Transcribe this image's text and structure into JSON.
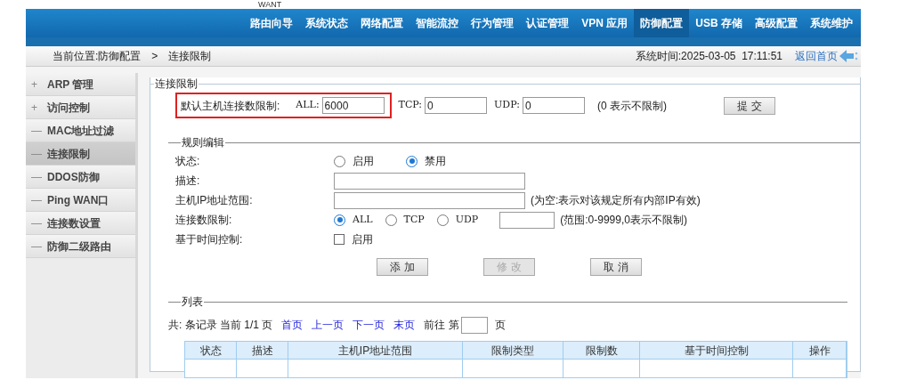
{
  "top_caption": "WANT",
  "nav": [
    {
      "label": "路由向导",
      "selected": false
    },
    {
      "label": "系统状态",
      "selected": false
    },
    {
      "label": "网络配置",
      "selected": false
    },
    {
      "label": "智能流控",
      "selected": false
    },
    {
      "label": "行为管理",
      "selected": false
    },
    {
      "label": "认证管理",
      "selected": false
    },
    {
      "label": "VPN 应用",
      "selected": false
    },
    {
      "label": "防御配置",
      "selected": true
    },
    {
      "label": "USB 存储",
      "selected": false
    },
    {
      "label": "高级配置",
      "selected": false
    },
    {
      "label": "系统维护",
      "selected": false
    }
  ],
  "breadcrumb": {
    "location": "当前位置:防御配置",
    "separator": ">",
    "current": "连接限制"
  },
  "system_time": "系统时间:2025-03-05  17:11:51",
  "home_link": "返回首页",
  "sidebar": [
    {
      "icon": "+",
      "label": "ARP 管理",
      "selected": false
    },
    {
      "icon": "+",
      "label": "访问控制",
      "selected": false
    },
    {
      "icon": "—",
      "label": "MAC地址过滤",
      "selected": false
    },
    {
      "icon": "—",
      "label": "连接限制",
      "selected": true
    },
    {
      "icon": "—",
      "label": "DDOS防御",
      "selected": false
    },
    {
      "icon": "—",
      "label": "Ping WAN口",
      "selected": false
    },
    {
      "icon": "—",
      "label": "连接数设置",
      "selected": false
    },
    {
      "icon": "—",
      "label": "防御二级路由",
      "selected": false
    }
  ],
  "default_limit": {
    "legend": "连接限制",
    "label": "默认主机连接数限制:",
    "highlighted": true,
    "fields": [
      {
        "label": "ALL:",
        "value": "6000"
      },
      {
        "label": "TCP:",
        "value": "0"
      },
      {
        "label": "UDP:",
        "value": "0"
      }
    ],
    "note": "(0 表示不限制)",
    "submit": "提 交"
  },
  "rule_edit": {
    "legend": "规则编辑",
    "rows": [
      {
        "kind": "radio",
        "label": "状态:",
        "options": [
          {
            "label": "启用",
            "selected": false
          },
          {
            "label": "禁用",
            "selected": true
          }
        ]
      },
      {
        "kind": "text",
        "label": "描述:"
      },
      {
        "kind": "text",
        "label": "主机IP地址范围:",
        "note": "(为空:表示对该规定所有内部IP有效)"
      },
      {
        "kind": "radio_input",
        "label": "连接数限制:",
        "options": [
          {
            "label": "ALL",
            "selected": true
          },
          {
            "label": "TCP",
            "selected": false
          },
          {
            "label": "UDP",
            "selected": false
          }
        ],
        "note": "(范围:0-9999,0表示不限制)"
      },
      {
        "kind": "checkbox",
        "label": "基于时间控制:",
        "option": "启用",
        "checked": false
      }
    ],
    "buttons": [
      {
        "label": "添 加",
        "disabled": false
      },
      {
        "label": "修 改",
        "disabled": true
      },
      {
        "label": "取 消",
        "disabled": false
      }
    ]
  },
  "list": {
    "legend": "列表",
    "summary": "共: 条记录 当前 1/1 页",
    "links": [
      "首页",
      "上一页",
      "下一页",
      "末页"
    ],
    "goto_label": "前往 第",
    "goto_suffix": "页",
    "columns": [
      "状态",
      "描述",
      "主机IP地址范围",
      "限制类型",
      "限制数",
      "基于时间控制",
      "操作"
    ]
  }
}
